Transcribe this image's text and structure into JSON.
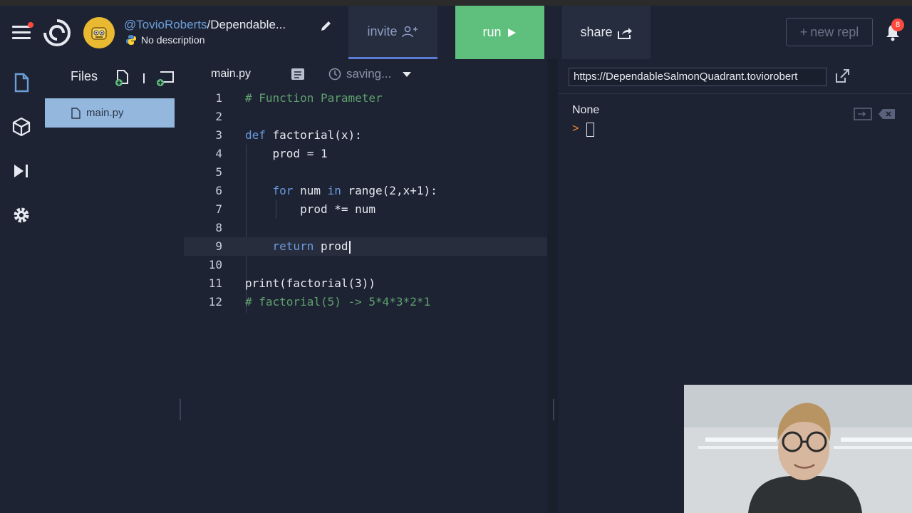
{
  "header": {
    "repl_user": "@TovioRoberts",
    "repl_separator": "/",
    "repl_name": "Dependable...",
    "description": "No description",
    "invite_label": "invite",
    "run_label": "run",
    "share_label": "share",
    "new_repl_label": "new repl",
    "notification_count": "8"
  },
  "files": {
    "title": "Files",
    "items": [
      {
        "label": "main.py"
      }
    ]
  },
  "editor": {
    "tab_label": "main.py",
    "status": "saving...",
    "lines": [
      {
        "n": "1",
        "text": "# Function Parameter"
      },
      {
        "n": "2",
        "text": ""
      },
      {
        "n": "3",
        "text": "def factorial(x):"
      },
      {
        "n": "4",
        "text": "    prod = 1"
      },
      {
        "n": "5",
        "text": ""
      },
      {
        "n": "6",
        "text": "    for num in range(2,x+1):"
      },
      {
        "n": "7",
        "text": "        prod *= num"
      },
      {
        "n": "8",
        "text": ""
      },
      {
        "n": "9",
        "text": "    return prod"
      },
      {
        "n": "10",
        "text": ""
      },
      {
        "n": "11",
        "text": "print(factorial(3))"
      },
      {
        "n": "12",
        "text": "# factorial(5) -> 5*4*3*2*1"
      }
    ],
    "active_line": "9"
  },
  "console": {
    "url": "https://DependableSalmonQuadrant.toviorobert",
    "output": "None",
    "prompt": ">"
  },
  "colors": {
    "background": "#1d2333",
    "run": "#5fbf7c",
    "accent": "#5b7bd4",
    "selected_file": "#94b8dd",
    "notification": "#ff4a3d"
  }
}
